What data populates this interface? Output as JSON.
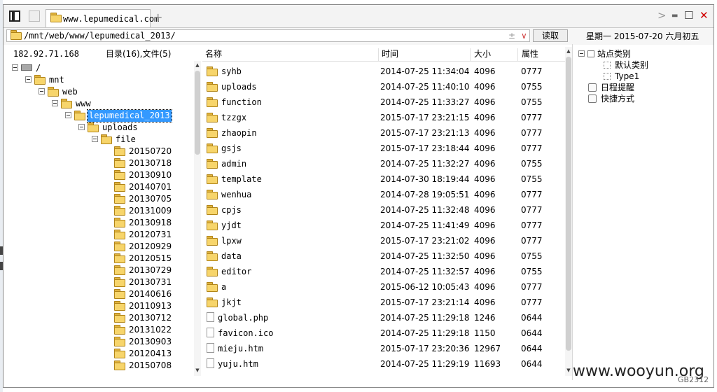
{
  "window": {
    "tab_title": "www.lepumedical.com",
    "tab_add": "+",
    "controls": {
      "forward": ">",
      "minimize": "▬",
      "maximize": "☐",
      "close": "✕"
    }
  },
  "address": {
    "path": "/mnt/web/www/lepumedical_2013/",
    "plus_symbol": "±",
    "dropdown_symbol": "∨",
    "read_button": "读取"
  },
  "date_display": "星期一 2015-07-20 六月初五",
  "left_panel": {
    "ip": "182.92.71.168",
    "summary": "目录(16),文件(5)",
    "tree": [
      {
        "label": "/",
        "level": 0,
        "icon": "drive"
      },
      {
        "label": "mnt",
        "level": 1,
        "icon": "folder"
      },
      {
        "label": "web",
        "level": 2,
        "icon": "folder"
      },
      {
        "label": "www",
        "level": 3,
        "icon": "folder"
      },
      {
        "label": "lepumedical_2013",
        "level": 4,
        "icon": "folder",
        "selected": true
      },
      {
        "label": "uploads",
        "level": 5,
        "icon": "folder"
      },
      {
        "label": "file",
        "level": 6,
        "icon": "folder"
      },
      {
        "label": "20150720",
        "level": 7,
        "icon": "folder"
      },
      {
        "label": "20130718",
        "level": 7,
        "icon": "folder"
      },
      {
        "label": "20130910",
        "level": 7,
        "icon": "folder"
      },
      {
        "label": "20140701",
        "level": 7,
        "icon": "folder"
      },
      {
        "label": "20130705",
        "level": 7,
        "icon": "folder"
      },
      {
        "label": "20131009",
        "level": 7,
        "icon": "folder"
      },
      {
        "label": "20130918",
        "level": 7,
        "icon": "folder"
      },
      {
        "label": "20120731",
        "level": 7,
        "icon": "folder"
      },
      {
        "label": "20120929",
        "level": 7,
        "icon": "folder"
      },
      {
        "label": "20120515",
        "level": 7,
        "icon": "folder"
      },
      {
        "label": "20130729",
        "level": 7,
        "icon": "folder"
      },
      {
        "label": "20130731",
        "level": 7,
        "icon": "folder"
      },
      {
        "label": "20140616",
        "level": 7,
        "icon": "folder"
      },
      {
        "label": "20110913",
        "level": 7,
        "icon": "folder"
      },
      {
        "label": "20130712",
        "level": 7,
        "icon": "folder"
      },
      {
        "label": "20131022",
        "level": 7,
        "icon": "folder"
      },
      {
        "label": "20130903",
        "level": 7,
        "icon": "folder"
      },
      {
        "label": "20120413",
        "level": 7,
        "icon": "folder"
      },
      {
        "label": "20150708",
        "level": 7,
        "icon": "folder"
      }
    ]
  },
  "file_list": {
    "columns": {
      "name": "名称",
      "time": "时间",
      "size": "大小",
      "attr": "属性"
    },
    "rows": [
      {
        "name": "syhb",
        "time": "2014-07-25 11:34:04",
        "size": "4096",
        "attr": "0777",
        "type": "folder"
      },
      {
        "name": "uploads",
        "time": "2014-07-25 11:40:10",
        "size": "4096",
        "attr": "0755",
        "type": "folder"
      },
      {
        "name": "function",
        "time": "2014-07-25 11:33:27",
        "size": "4096",
        "attr": "0755",
        "type": "folder"
      },
      {
        "name": "tzzgx",
        "time": "2015-07-17 23:21:15",
        "size": "4096",
        "attr": "0777",
        "type": "folder"
      },
      {
        "name": "zhaopin",
        "time": "2015-07-17 23:21:13",
        "size": "4096",
        "attr": "0777",
        "type": "folder"
      },
      {
        "name": "gsjs",
        "time": "2015-07-17 23:18:44",
        "size": "4096",
        "attr": "0777",
        "type": "folder"
      },
      {
        "name": "admin",
        "time": "2014-07-25 11:32:27",
        "size": "4096",
        "attr": "0755",
        "type": "folder"
      },
      {
        "name": "template",
        "time": "2014-07-30 18:19:44",
        "size": "4096",
        "attr": "0755",
        "type": "folder"
      },
      {
        "name": "wenhua",
        "time": "2014-07-28 19:05:51",
        "size": "4096",
        "attr": "0777",
        "type": "folder"
      },
      {
        "name": "cpjs",
        "time": "2014-07-25 11:32:48",
        "size": "4096",
        "attr": "0777",
        "type": "folder"
      },
      {
        "name": "yjdt",
        "time": "2014-07-25 11:41:49",
        "size": "4096",
        "attr": "0777",
        "type": "folder"
      },
      {
        "name": "lpxw",
        "time": "2015-07-17 23:21:02",
        "size": "4096",
        "attr": "0777",
        "type": "folder"
      },
      {
        "name": "data",
        "time": "2014-07-25 11:32:50",
        "size": "4096",
        "attr": "0755",
        "type": "folder"
      },
      {
        "name": "editor",
        "time": "2014-07-25 11:32:57",
        "size": "4096",
        "attr": "0755",
        "type": "folder"
      },
      {
        "name": "a",
        "time": "2015-06-12 10:05:43",
        "size": "4096",
        "attr": "0777",
        "type": "folder"
      },
      {
        "name": "jkjt",
        "time": "2015-07-17 23:21:14",
        "size": "4096",
        "attr": "0777",
        "type": "folder"
      },
      {
        "name": "global.php",
        "time": "2014-07-25 11:29:18",
        "size": "1246",
        "attr": "0644",
        "type": "file"
      },
      {
        "name": "favicon.ico",
        "time": "2014-07-25 11:29:18",
        "size": "1150",
        "attr": "0644",
        "type": "file"
      },
      {
        "name": "mieju.htm",
        "time": "2015-07-17 23:20:36",
        "size": "12967",
        "attr": "0644",
        "type": "file"
      },
      {
        "name": "yuju.htm",
        "time": "2014-07-25 11:29:19",
        "size": "11693",
        "attr": "0644",
        "type": "file"
      }
    ]
  },
  "side_panel": {
    "tree": [
      {
        "label": "站点类别",
        "icon": "box",
        "level": 0
      },
      {
        "label": "默认类别",
        "icon": "dotbox",
        "level": 1
      },
      {
        "label": "Type1",
        "icon": "dotbox",
        "level": 1
      },
      {
        "label": "日程提醒",
        "icon": "clock",
        "level": 0
      },
      {
        "label": "快捷方式",
        "icon": "shortcut",
        "level": 0
      }
    ]
  },
  "watermark": "www.wooyun.org",
  "encoding": "GB2312"
}
